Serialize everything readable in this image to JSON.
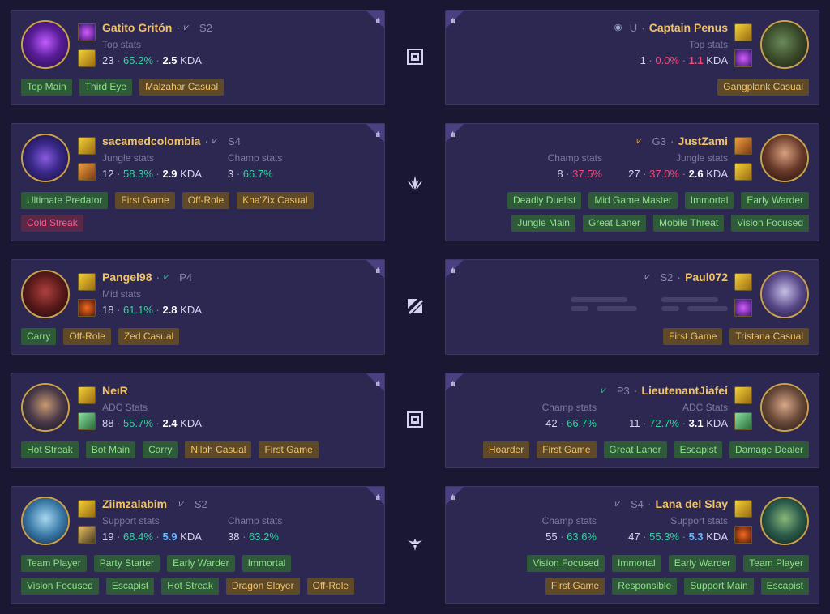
{
  "matches": [
    {
      "mid_icon": "top-lane-icon",
      "left": {
        "name": "Gatito Gritón",
        "rank": "S2",
        "rank_icon": "silver-rank-icon",
        "stat_label": "Top stats",
        "games": "23",
        "wr": "65.2%",
        "kda": "2.5",
        "kda_suffix": "KDA",
        "tags": [
          {
            "label": "Top Main",
            "color": "green"
          },
          {
            "label": "Third Eye",
            "color": "green"
          },
          {
            "label": "Malzahar Casual",
            "color": "gold"
          }
        ]
      },
      "right": {
        "name": "Captain Penus",
        "rank": "U",
        "rank_icon": "unranked-icon",
        "stat_label": "Top stats",
        "games": "1",
        "wr": "0.0%",
        "kda": "1.1",
        "kda_suffix": "KDA",
        "tags": [
          {
            "label": "Gangplank Casual",
            "color": "gold"
          }
        ]
      }
    },
    {
      "mid_icon": "jungle-icon",
      "left": {
        "name": "sacamedcolombia",
        "rank": "S4",
        "rank_icon": "silver-rank-icon",
        "stat_label": "Jungle stats",
        "games": "12",
        "wr": "58.3%",
        "kda": "2.9",
        "kda_suffix": "KDA",
        "champ_label": "Champ stats",
        "champ_games": "3",
        "champ_wr": "66.7%",
        "tags": [
          {
            "label": "Ultimate Predator",
            "color": "green"
          },
          {
            "label": "First Game",
            "color": "gold"
          },
          {
            "label": "Off-Role",
            "color": "gold"
          },
          {
            "label": "Kha'Zix Casual",
            "color": "gold"
          }
        ],
        "tags2": [
          {
            "label": "Cold Streak",
            "color": "red"
          }
        ]
      },
      "right": {
        "name": "JustZami",
        "rank": "G3",
        "rank_icon": "gold-rank-icon",
        "stat_label": "Jungle stats",
        "games": "27",
        "wr": "37.0%",
        "kda": "2.6",
        "kda_suffix": "KDA",
        "champ_label": "Champ stats",
        "champ_games": "8",
        "champ_wr": "37.5%",
        "tags": [
          {
            "label": "Deadly Duelist",
            "color": "green"
          },
          {
            "label": "Mid Game Master",
            "color": "green"
          },
          {
            "label": "Immortal",
            "color": "green"
          },
          {
            "label": "Early Warder",
            "color": "green"
          }
        ],
        "tags2": [
          {
            "label": "Jungle Main",
            "color": "green"
          },
          {
            "label": "Great Laner",
            "color": "green"
          },
          {
            "label": "Mobile Threat",
            "color": "green"
          },
          {
            "label": "Vision Focused",
            "color": "green"
          }
        ]
      }
    },
    {
      "mid_icon": "mid-lane-icon",
      "left": {
        "name": "Pangel98",
        "rank": "P4",
        "rank_icon": "platinum-rank-icon",
        "stat_label": "Mid stats",
        "games": "18",
        "wr": "61.1%",
        "kda": "2.8",
        "kda_suffix": "KDA",
        "tags": [
          {
            "label": "Carry",
            "color": "green"
          },
          {
            "label": "Off-Role",
            "color": "gold"
          },
          {
            "label": "Zed Casual",
            "color": "gold"
          }
        ]
      },
      "right": {
        "name": "Paul072",
        "rank": "S2",
        "rank_icon": "silver-rank-icon",
        "tags": [
          {
            "label": "First Game",
            "color": "gold"
          },
          {
            "label": "Tristana Casual",
            "color": "gold"
          }
        ]
      }
    },
    {
      "mid_icon": "bot-lane-icon",
      "left": {
        "name": "NeιR",
        "stat_label": "ADC Stats",
        "games": "88",
        "wr": "55.7%",
        "kda": "2.4",
        "kda_suffix": "KDA",
        "tags": [
          {
            "label": "Hot Streak",
            "color": "green"
          },
          {
            "label": "Bot Main",
            "color": "green"
          },
          {
            "label": "Carry",
            "color": "green"
          },
          {
            "label": "Nilah Casual",
            "color": "gold"
          },
          {
            "label": "First Game",
            "color": "gold"
          }
        ]
      },
      "right": {
        "name": "LieutenantJiafei",
        "rank": "P3",
        "rank_icon": "platinum-rank-icon",
        "stat_label": "ADC Stats",
        "games": "11",
        "wr": "72.7%",
        "kda": "3.1",
        "kda_suffix": "KDA",
        "champ_label": "Champ stats",
        "champ_games": "42",
        "champ_wr": "66.7%",
        "tags": [
          {
            "label": "Hoarder",
            "color": "gold"
          },
          {
            "label": "First Game",
            "color": "gold"
          },
          {
            "label": "Great Laner",
            "color": "green"
          },
          {
            "label": "Escapist",
            "color": "green"
          },
          {
            "label": "Damage Dealer",
            "color": "green"
          }
        ]
      }
    },
    {
      "mid_icon": "support-icon",
      "left": {
        "name": "Ziimzalabim",
        "rank": "S2",
        "rank_icon": "silver-rank-icon",
        "stat_label": "Support stats",
        "games": "19",
        "wr": "68.4%",
        "kda": "5.9",
        "kda_suffix": "KDA",
        "champ_label": "Champ stats",
        "champ_games": "38",
        "champ_wr": "63.2%",
        "tags": [
          {
            "label": "Team Player",
            "color": "green"
          },
          {
            "label": "Party Starter",
            "color": "green"
          },
          {
            "label": "Early Warder",
            "color": "green"
          },
          {
            "label": "Immortal",
            "color": "green"
          }
        ],
        "tags2": [
          {
            "label": "Vision Focused",
            "color": "green"
          },
          {
            "label": "Escapist",
            "color": "green"
          },
          {
            "label": "Hot Streak",
            "color": "green"
          },
          {
            "label": "Dragon Slayer",
            "color": "gold"
          },
          {
            "label": "Off-Role",
            "color": "gold"
          }
        ]
      },
      "right": {
        "name": "Lana del Slay",
        "rank": "S4",
        "rank_icon": "silver-rank-icon",
        "stat_label": "Support stats",
        "games": "47",
        "wr": "55.3%",
        "kda": "5.3",
        "kda_suffix": "KDA",
        "champ_label": "Champ stats",
        "champ_games": "55",
        "champ_wr": "63.6%",
        "tags": [
          {
            "label": "Vision Focused",
            "color": "green"
          },
          {
            "label": "Immortal",
            "color": "green"
          },
          {
            "label": "Early Warder",
            "color": "green"
          },
          {
            "label": "Team Player",
            "color": "green"
          }
        ],
        "tags2": [
          {
            "label": "First Game",
            "color": "gold"
          },
          {
            "label": "Responsible",
            "color": "green"
          },
          {
            "label": "Support Main",
            "color": "green"
          },
          {
            "label": "Escapist",
            "color": "green"
          }
        ]
      }
    }
  ],
  "colors": {
    "background": "#1a1733",
    "card": "#2c2852",
    "name": "#f0c26a",
    "win_good": "#3ad0a0",
    "win_bad": "#f04a7a",
    "kda_high": "#6ab6ff",
    "tag_green": "#8ee08a",
    "tag_gold": "#f0c26a",
    "tag_red": "#ff5a8a"
  }
}
